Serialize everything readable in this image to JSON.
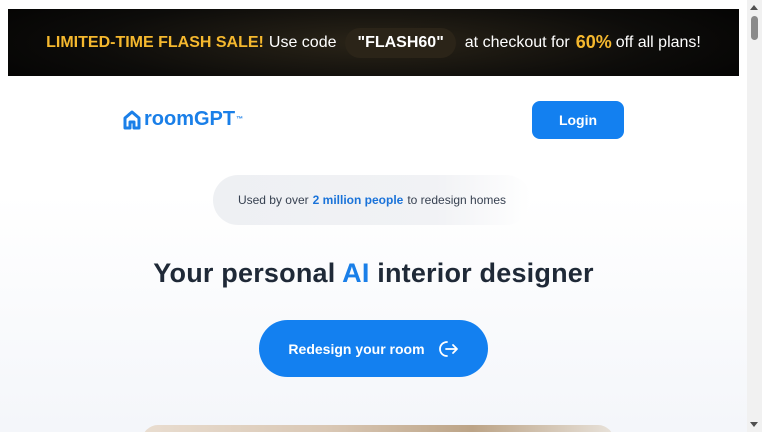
{
  "promo": {
    "lead": "LIMITED-TIME FLASH SALE!",
    "use_code": "Use code",
    "code": "\"FLASH60\"",
    "at_checkout": "at checkout for",
    "percent": "60%",
    "tail": "off all plans!"
  },
  "header": {
    "logo_text": "roomGPT",
    "logo_mark": "™",
    "login_label": "Login"
  },
  "hero": {
    "pill_prefix": "Used by over",
    "pill_highlight": "2 million people",
    "pill_suffix": "to redesign homes",
    "headline_prefix": "Your personal",
    "headline_highlight": "AI",
    "headline_suffix": "interior designer",
    "cta_label": "Redesign your room",
    "cta_icon": "sign-out-arrow-icon"
  },
  "colors": {
    "accent": "#1380f0",
    "promo_highlight": "#f5b82e",
    "promo_background": "#000000"
  }
}
